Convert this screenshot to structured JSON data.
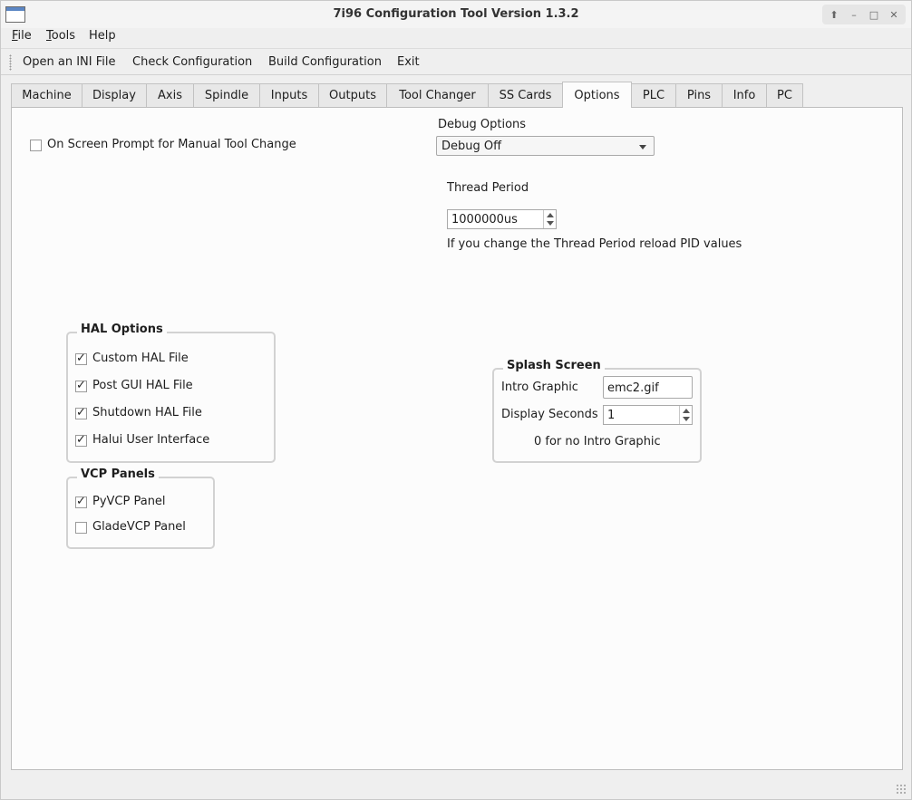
{
  "window": {
    "title": "7i96 Configuration Tool Version 1.3.2"
  },
  "menu": [
    {
      "label": "File",
      "mnemonic": "F",
      "rest": "ile"
    },
    {
      "label": "Tools",
      "mnemonic": "T",
      "rest": "ools"
    },
    {
      "label": "Help",
      "mnemonic": "",
      "rest": "Help"
    }
  ],
  "toolbar": {
    "open_ini": "Open an INI File",
    "check_config": "Check Configuration",
    "build_config": "Build Configuration",
    "exit": "Exit"
  },
  "tabs": [
    "Machine",
    "Display",
    "Axis",
    "Spindle",
    "Inputs",
    "Outputs",
    "Tool Changer",
    "SS Cards",
    "Options",
    "PLC",
    "Pins",
    "Info",
    "PC"
  ],
  "active_tab": "Options",
  "options": {
    "manual_tool_change": {
      "label": "On Screen Prompt for Manual Tool Change",
      "checked": false
    },
    "debug": {
      "label": "Debug Options",
      "selected": "Debug Off"
    },
    "thread_period": {
      "label": "Thread Period",
      "value": "1000000us",
      "note": "If you change the Thread Period reload PID values"
    },
    "hal_options": {
      "title": "HAL Options",
      "items": [
        {
          "label": "Custom HAL File",
          "checked": true
        },
        {
          "label": "Post GUI HAL File",
          "checked": true
        },
        {
          "label": "Shutdown HAL File",
          "checked": true
        },
        {
          "label": "Halui User Interface",
          "checked": true
        }
      ]
    },
    "vcp_panels": {
      "title": "VCP Panels",
      "items": [
        {
          "label": "PyVCP Panel",
          "checked": true
        },
        {
          "label": "GladeVCP Panel",
          "checked": false
        }
      ]
    },
    "splash": {
      "title": "Splash Screen",
      "intro_label": "Intro Graphic",
      "intro_value": "emc2.gif",
      "seconds_label": "Display Seconds",
      "seconds_value": "1",
      "note": "0 for no Intro Graphic"
    }
  }
}
